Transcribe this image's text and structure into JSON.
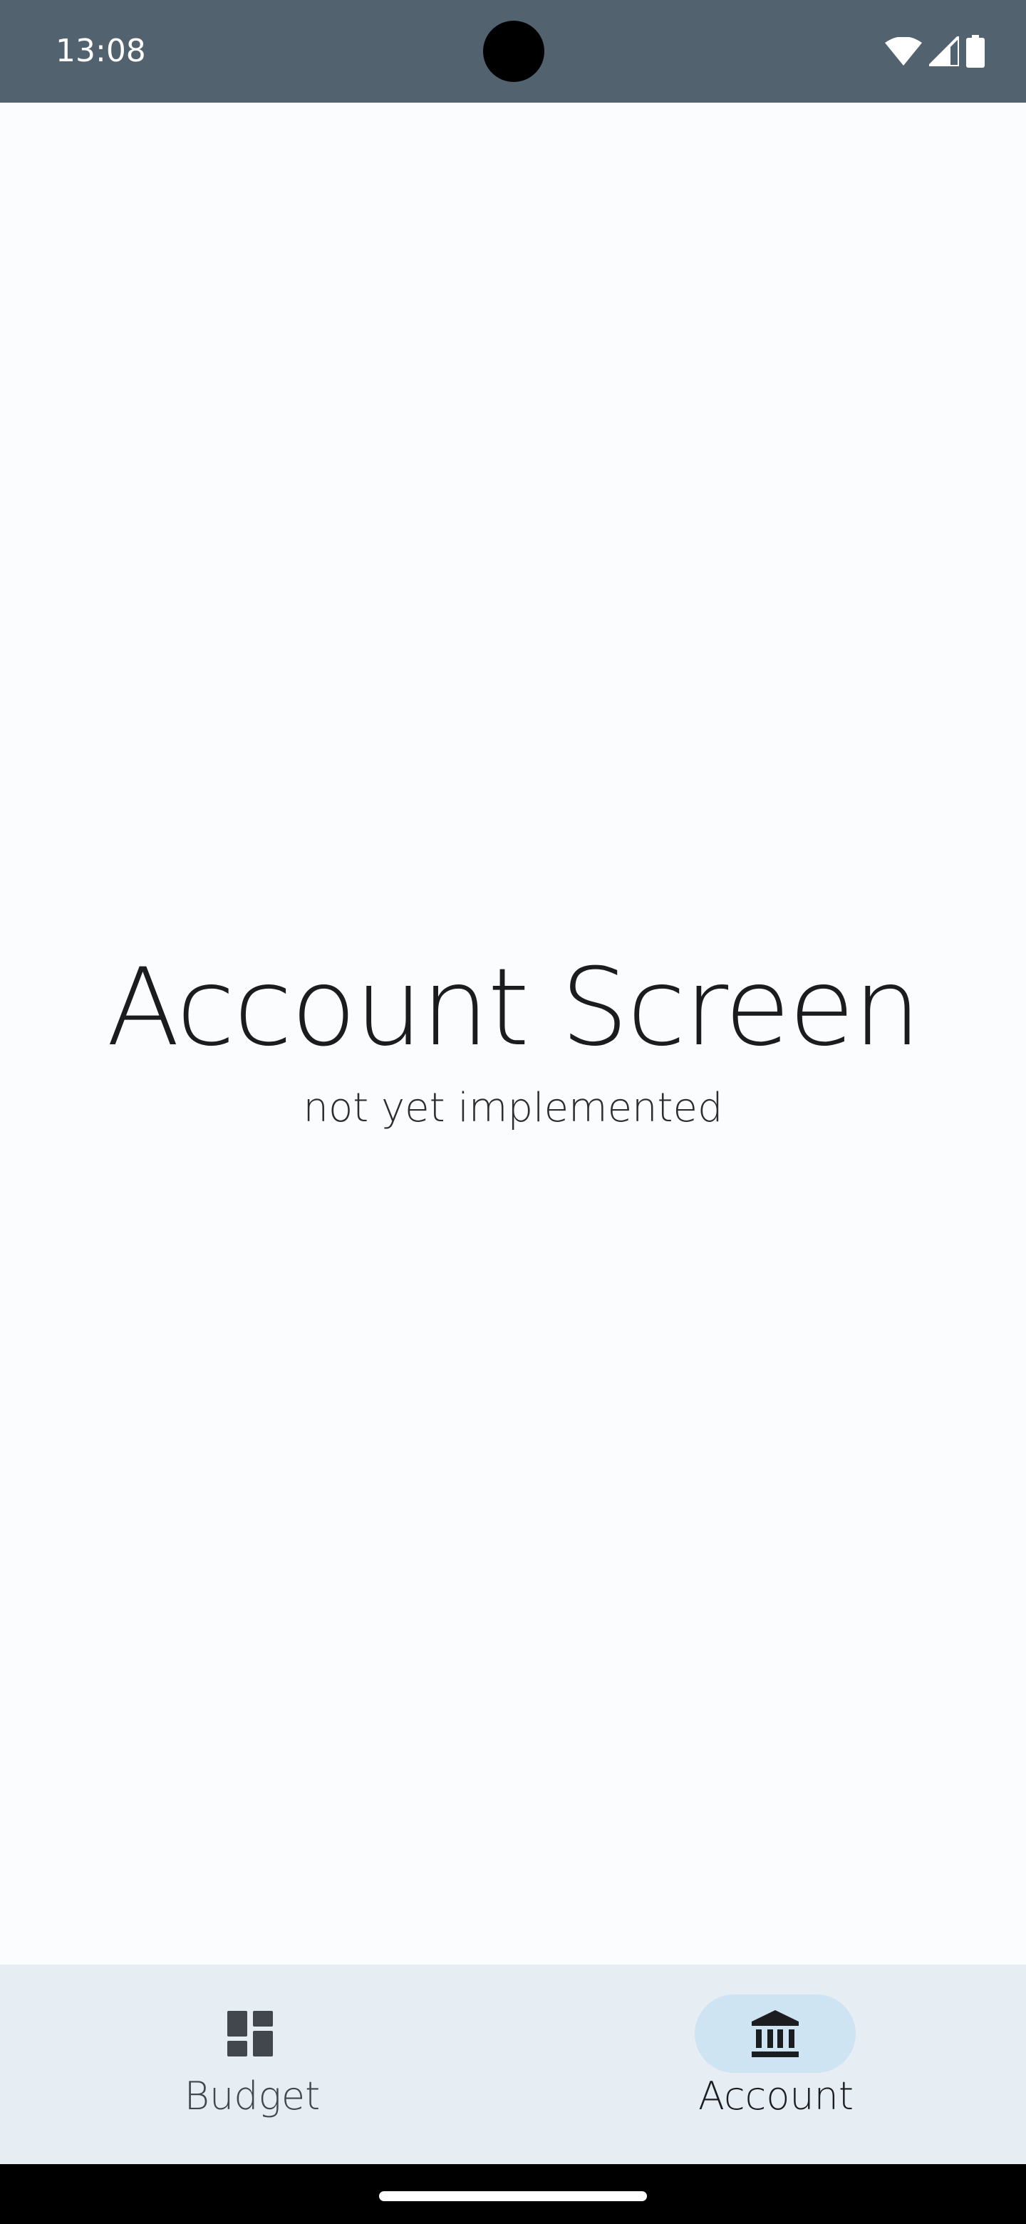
{
  "status_bar": {
    "time": "13:08",
    "background": "#52626e",
    "icons": [
      "wifi-icon",
      "cell-signal-icon",
      "battery-icon"
    ]
  },
  "main": {
    "title": "Account Screen",
    "subtitle": "not yet implemented"
  },
  "bottom_nav": {
    "background": "#e6eef4",
    "items": [
      {
        "label": "Budget",
        "icon": "dashboard-icon",
        "selected": false
      },
      {
        "label": "Account",
        "icon": "bank-icon",
        "selected": true
      }
    ],
    "selected_indicator_color": "#cfe4f3"
  }
}
